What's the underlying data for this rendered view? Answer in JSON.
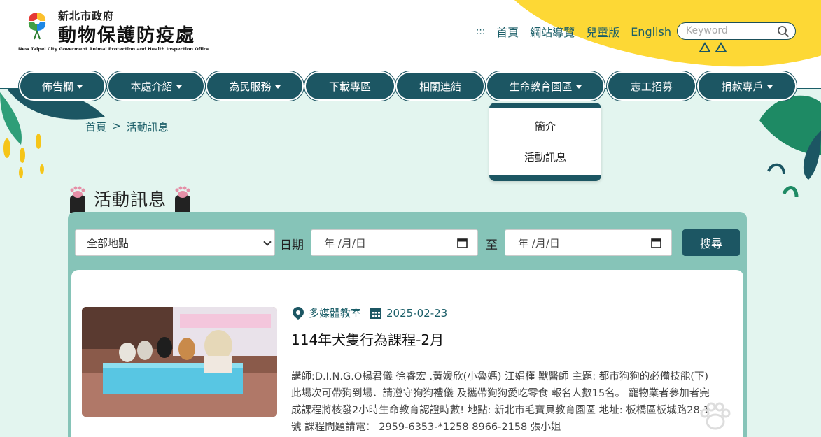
{
  "header": {
    "logo_small": "新北市政府",
    "logo_big": "動物保護防疫處",
    "logo_en": "New Taipei City Goverment Animal Protection and Health Inspection Office",
    "sep": ":::",
    "links": [
      "首頁",
      "網站導覽",
      "兒童版",
      "English"
    ],
    "search_placeholder": "Keyword"
  },
  "nav": {
    "items": [
      {
        "label": "佈告欄"
      },
      {
        "label": "本處介紹"
      },
      {
        "label": "為民服務"
      },
      {
        "label": "下載專區"
      },
      {
        "label": "相關連結"
      },
      {
        "label": "生命教育園區"
      },
      {
        "label": "志工招募"
      },
      {
        "label": "捐款專戶"
      }
    ],
    "dropdown": [
      "簡介",
      "活動訊息"
    ]
  },
  "breadcrumb": {
    "home": "首頁",
    "sep": ">",
    "current": "活動訊息"
  },
  "page_title": "活動訊息",
  "filter": {
    "location_value": "全部地點",
    "date_label": "日期",
    "date_placeholder": "年 /月/日",
    "to_label": "至",
    "search_button": "搜尋"
  },
  "event": {
    "location": "多媒體教室",
    "date": "2025-02-23",
    "title": "114年犬隻行為課程-2月",
    "description": "講師:D.I.N.G.O楊君儀 徐睿宏 .黃媛欣(小魯媽) 江娟槿 獸醫師 主題: 都市狗狗的必備技能(下) 此場次可帶狗到場．請遵守狗狗禮儀 及攜帶狗狗愛吃零食 報名人數15名。 寵物業者參加者完成課程將核發2小時生命教育認證時數! 地點: 新北市毛寶貝教育園區 地址: 板橋區板城路28-1號 課程問題請電： 2959-6353-*1258 8966-2158 張小姐"
  },
  "colors": {
    "accent": "#1c5663",
    "panel": "#86c4b8",
    "background": "#e3f5ef",
    "yellow": "#fdd835"
  }
}
